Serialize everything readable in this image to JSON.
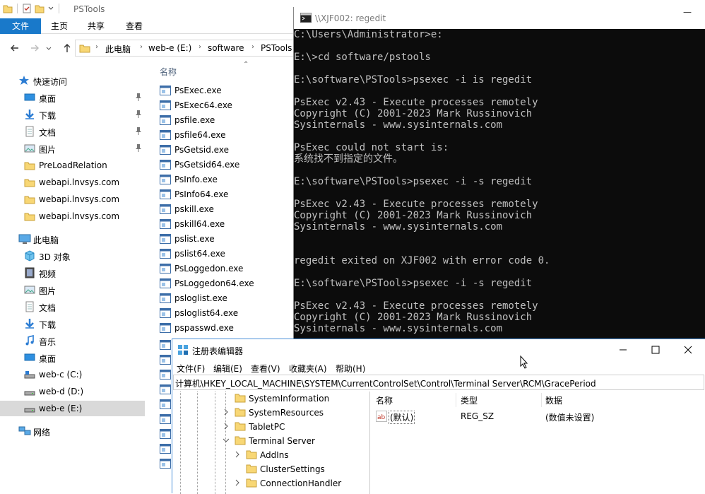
{
  "explorer": {
    "title": "PSTools",
    "ribbon_tabs": [
      "文件",
      "主页",
      "共享",
      "查看"
    ],
    "breadcrumb": [
      "此电脑",
      "web-e (E:)",
      "software",
      "PSTools"
    ],
    "nav": {
      "quick_access": "快速访问",
      "quick_items": [
        {
          "label": "桌面",
          "icon": "desktop-icon",
          "pinned": true
        },
        {
          "label": "下载",
          "icon": "download-icon",
          "pinned": true
        },
        {
          "label": "文档",
          "icon": "documents-icon",
          "pinned": true
        },
        {
          "label": "图片",
          "icon": "pictures-icon",
          "pinned": true
        },
        {
          "label": "PreLoadRelation",
          "icon": "folder-icon"
        },
        {
          "label": "webapi.lnvsys.com",
          "icon": "folder-icon"
        },
        {
          "label": "webapi.lnvsys.com",
          "icon": "folder-icon"
        },
        {
          "label": "webapi.lnvsys.com",
          "icon": "folder-icon"
        }
      ],
      "this_pc": "此电脑",
      "pc_items": [
        {
          "label": "3D 对象",
          "icon": "3d-objects-icon"
        },
        {
          "label": "视频",
          "icon": "videos-icon"
        },
        {
          "label": "图片",
          "icon": "pictures-icon"
        },
        {
          "label": "文档",
          "icon": "documents-icon"
        },
        {
          "label": "下载",
          "icon": "download-icon"
        },
        {
          "label": "音乐",
          "icon": "music-icon"
        },
        {
          "label": "桌面",
          "icon": "desktop-icon"
        },
        {
          "label": "web-c (C:)",
          "icon": "drive-c-icon"
        },
        {
          "label": "web-d (D:)",
          "icon": "drive-icon"
        },
        {
          "label": "web-e (E:)",
          "icon": "drive-icon",
          "selected": true
        }
      ],
      "network": "网络"
    },
    "column_header": "名称",
    "files": [
      "PsExec.exe",
      "PsExec64.exe",
      "psfile.exe",
      "psfile64.exe",
      "PsGetsid.exe",
      "PsGetsid64.exe",
      "PsInfo.exe",
      "PsInfo64.exe",
      "pskill.exe",
      "pskill64.exe",
      "pslist.exe",
      "pslist64.exe",
      "PsLoggedon.exe",
      "PsLoggedon64.exe",
      "psloglist.exe",
      "psloglist64.exe",
      "pspasswd.exe"
    ]
  },
  "console": {
    "title": "\\\\XJF002: regedit",
    "minimize": "—",
    "lines": [
      "C:\\Users\\Administrator>e:",
      "",
      "E:\\>cd software/pstools",
      "",
      "E:\\software\\PSTools>psexec -i is regedit",
      "",
      "PsExec v2.43 - Execute processes remotely",
      "Copyright (C) 2001-2023 Mark Russinovich",
      "Sysinternals - www.sysinternals.com",
      "",
      "PsExec could not start is:",
      "系统找不到指定的文件。",
      "",
      "E:\\software\\PSTools>psexec -i -s regedit",
      "",
      "PsExec v2.43 - Execute processes remotely",
      "Copyright (C) 2001-2023 Mark Russinovich",
      "Sysinternals - www.sysinternals.com",
      "",
      "",
      "regedit exited on XJF002 with error code 0.",
      "",
      "E:\\software\\PSTools>psexec -i -s regedit",
      "",
      "PsExec v2.43 - Execute processes remotely",
      "Copyright (C) 2001-2023 Mark Russinovich",
      "Sysinternals - www.sysinternals.com"
    ]
  },
  "regedit": {
    "title": "注册表编辑器",
    "menu": [
      "文件(F)",
      "编辑(E)",
      "查看(V)",
      "收藏夹(A)",
      "帮助(H)"
    ],
    "address": "计算机\\HKEY_LOCAL_MACHINE\\SYSTEM\\CurrentControlSet\\Control\\Terminal Server\\RCM\\GracePeriod",
    "tree": [
      {
        "label": "SystemInformation",
        "level": 0,
        "expander": "none"
      },
      {
        "label": "SystemResources",
        "level": 0,
        "expander": "collapsed"
      },
      {
        "label": "TabletPC",
        "level": 0,
        "expander": "collapsed"
      },
      {
        "label": "Terminal Server",
        "level": 0,
        "expander": "expanded"
      },
      {
        "label": "AddIns",
        "level": 1,
        "expander": "collapsed"
      },
      {
        "label": "ClusterSettings",
        "level": 1,
        "expander": "none"
      },
      {
        "label": "ConnectionHandler",
        "level": 1,
        "expander": "collapsed"
      }
    ],
    "columns": [
      "名称",
      "类型",
      "数据"
    ],
    "values": [
      {
        "name": "(默认)",
        "type": "REG_SZ",
        "data": "(数值未设置)"
      }
    ]
  },
  "colors": {
    "ribbon_file_tab": "#1979ca",
    "folder": "#f8d775",
    "console_bg": "#0c0c0c",
    "console_fg": "#c0c0c0",
    "selection": "#d9d9d9"
  }
}
